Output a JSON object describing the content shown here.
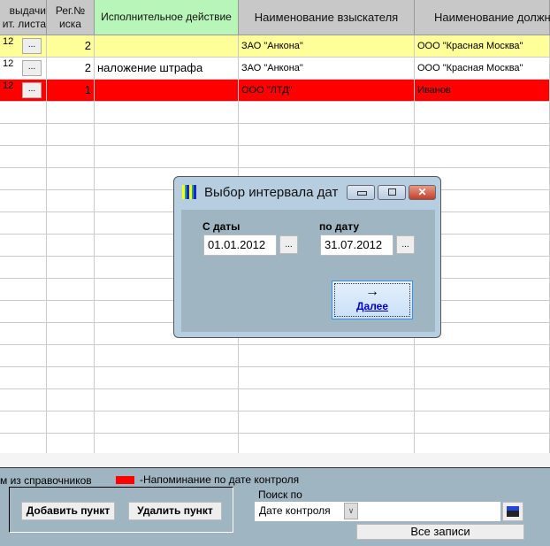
{
  "grid": {
    "headers": [
      "выдачи\nит. листа",
      "Рег.№\nиска",
      "Исполнительное действие",
      "Наименование взыскателя",
      "Наименование должн"
    ],
    "rows": [
      {
        "date": "12",
        "reg": "2",
        "action": "",
        "claimant": "ЗАО \"Анкона\"",
        "debtor": "ООО \"Красная Москва\"",
        "color": "#ffff99"
      },
      {
        "date": "12",
        "reg": "2",
        "action": "наложение штрафа",
        "claimant": "ЗАО \"Анкона\"",
        "debtor": "ООО \"Красная Москва\"",
        "color": "#ffffff"
      },
      {
        "date": "12",
        "reg": "1",
        "action": "",
        "claimant": "ООО \"ЛТД\"",
        "debtor": "Иванов",
        "color": "#ff0000"
      }
    ],
    "dots_label": "..."
  },
  "legend": {
    "left_text": "м из справочников",
    "reminder_text": "-Напоминание по дате контроля",
    "reminder_color": "#ff0000"
  },
  "buttons": {
    "add": "Добавить пункт",
    "delete": "Удалить пункт",
    "all": "Все записи"
  },
  "search": {
    "label": "Поиск по",
    "field": "Дате контроля",
    "value": ""
  },
  "dialog": {
    "title": "Выбор интервала дат",
    "from_label": "С даты",
    "from_value": "01.01.2012",
    "to_label": "по дату",
    "to_value": "31.07.2012",
    "next_label": "Далее",
    "next_icon": "→",
    "dots": "..."
  }
}
